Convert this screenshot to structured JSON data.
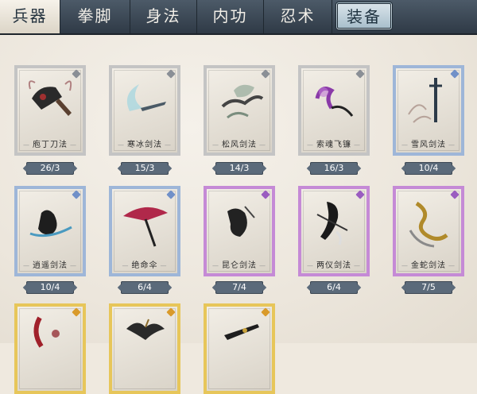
{
  "tabs": [
    {
      "label": "兵器",
      "state": "selected"
    },
    {
      "label": "拳脚",
      "state": "normal"
    },
    {
      "label": "身法",
      "state": "normal"
    },
    {
      "label": "内功",
      "state": "normal"
    },
    {
      "label": "忍术",
      "state": "normal"
    },
    {
      "label": "装备",
      "state": "highlighted"
    }
  ],
  "cards": [
    {
      "name": "庖丁刀法",
      "level": "26/3",
      "rarity": "grey",
      "icon": "cleaver-icon"
    },
    {
      "name": "寒冰剑法",
      "level": "15/3",
      "rarity": "grey",
      "icon": "ice-sword-icon"
    },
    {
      "name": "松风剑法",
      "level": "14/3",
      "rarity": "grey",
      "icon": "pine-sword-icon"
    },
    {
      "name": "索魂飞镰",
      "level": "16/3",
      "rarity": "grey",
      "icon": "sickle-icon"
    },
    {
      "name": "雪风剑法",
      "level": "10/4",
      "rarity": "blue",
      "icon": "snow-sword-icon"
    },
    {
      "name": "逍遥剑法",
      "level": "10/4",
      "rarity": "blue",
      "icon": "swordsman-icon"
    },
    {
      "name": "绝命伞",
      "level": "6/4",
      "rarity": "blue",
      "icon": "umbrella-icon"
    },
    {
      "name": "昆仑剑法",
      "level": "7/4",
      "rarity": "purple",
      "icon": "kunlun-icon"
    },
    {
      "name": "两仪剑法",
      "level": "6/4",
      "rarity": "purple",
      "icon": "dual-sword-icon"
    },
    {
      "name": "金蛇剑法",
      "level": "7/5",
      "rarity": "purple",
      "icon": "golden-snake-sword-icon"
    },
    {
      "name": "",
      "level": "",
      "rarity": "gold",
      "icon": "crimson-blade-icon"
    },
    {
      "name": "",
      "level": "",
      "rarity": "gold",
      "icon": "dragon-icon"
    },
    {
      "name": "",
      "level": "",
      "rarity": "gold",
      "icon": "black-blade-icon"
    }
  ]
}
